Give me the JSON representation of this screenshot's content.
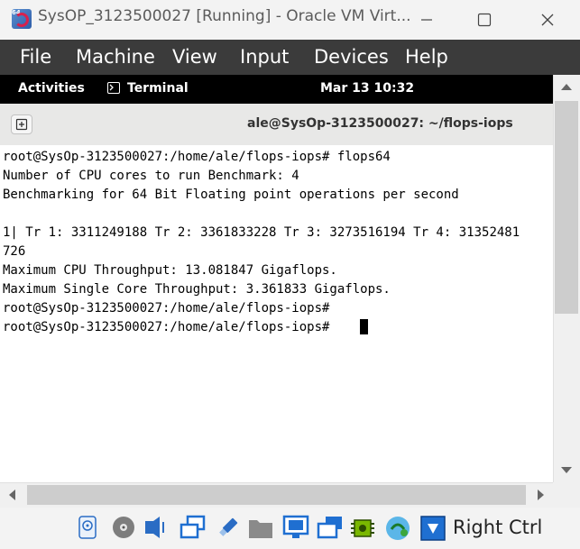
{
  "window": {
    "title": "SysOP_3123500027 [Running] - Oracle VM Virt...",
    "app_icon_tag": "64"
  },
  "menubar": {
    "items": [
      "File",
      "Machine",
      "View",
      "Input",
      "Devices",
      "Help"
    ]
  },
  "guest_topbar": {
    "activities": "Activities",
    "app": "Terminal",
    "clock": "Mar 13  10:32"
  },
  "terminal": {
    "title": "ale@SysOp-3123500027: ~/flops-iops",
    "lines": [
      "root@SysOp-3123500027:/home/ale/flops-iops# flops64",
      "Number of CPU cores to run Benchmark: 4",
      "Benchmarking for 64 Bit Floating point operations per second",
      "",
      "1| Tr 1: 3311249188 Tr 2: 3361833228 Tr 3: 3273516194 Tr 4: 31352481",
      "726",
      "Maximum CPU Throughput: 13.081847 Gigaflops.",
      "Maximum Single Core Throughput: 3.361833 Gigaflops.",
      "root@SysOp-3123500027:/home/ale/flops-iops#",
      "root@SysOp-3123500027:/home/ale/flops-iops# "
    ]
  },
  "statusbar": {
    "icons": [
      "hard-disk-icon",
      "optical-drive-icon",
      "audio-icon",
      "network-icon",
      "usb-icon",
      "shared-folders-icon",
      "display-icon",
      "recording-icon",
      "cpu-icon",
      "mouse-integration-icon",
      "keyboard-capture-icon"
    ],
    "host_key": "Right Ctrl"
  },
  "colors": {
    "menubar": "#3b3b3b",
    "guest_topbar": "#000000",
    "terminal_bg": "#ffffff",
    "accent_blue": "#1f6fd1"
  }
}
